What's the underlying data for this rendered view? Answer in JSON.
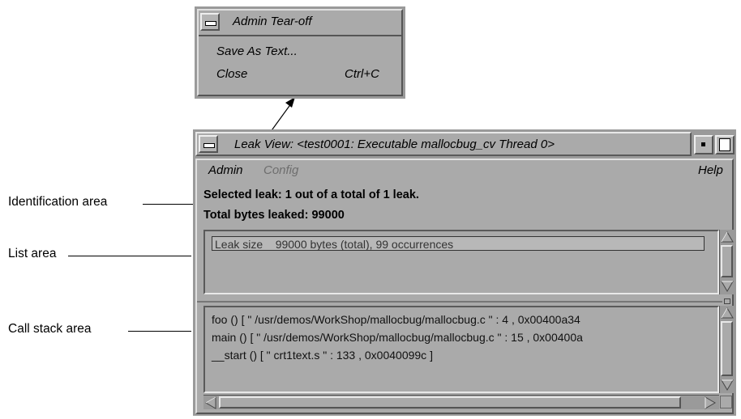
{
  "tearoff": {
    "title": "Admin Tear-off",
    "items": [
      {
        "label": "Save As Text...",
        "shortcut": ""
      },
      {
        "label": "Close",
        "shortcut": "Ctrl+C"
      }
    ]
  },
  "window": {
    "title": "Leak View: <test0001: Executable mallocbug_cv Thread 0>"
  },
  "menubar": {
    "admin": "Admin",
    "config": "Config",
    "help": "Help"
  },
  "identification": {
    "selected": "Selected leak: 1 out of a total of 1 leak.",
    "total": "Total bytes leaked: 99000"
  },
  "list": {
    "items": [
      "Leak size    99000 bytes (total), 99 occurrences"
    ]
  },
  "callstack": {
    "lines": [
      "foo () [ \" /usr/demos/WorkShop/mallocbug/mallocbug.c \" : 4 , 0x00400a34",
      "main () [ \" /usr/demos/WorkShop/mallocbug/mallocbug.c \" : 15 , 0x00400a",
      "__start () [ \" crt1text.s \" : 133 , 0x0040099c ]"
    ]
  },
  "callouts": {
    "identification": "Identification area",
    "list": "List area",
    "callstack": "Call stack area"
  }
}
